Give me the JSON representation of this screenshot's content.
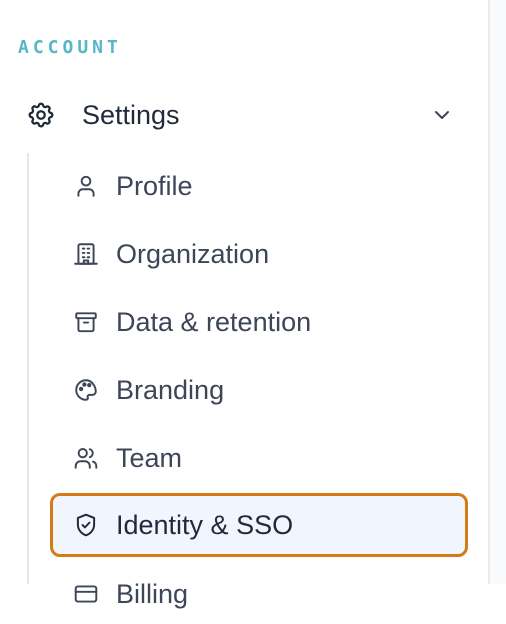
{
  "sidebar": {
    "section_heading": "ACCOUNT",
    "group": {
      "label": "Settings",
      "icon": "gear-icon",
      "expand_icon": "chevron-down-icon"
    },
    "items": [
      {
        "label": "Profile",
        "icon": "user-icon"
      },
      {
        "label": "Organization",
        "icon": "building-icon"
      },
      {
        "label": "Data & retention",
        "icon": "archive-icon"
      },
      {
        "label": "Branding",
        "icon": "palette-icon"
      },
      {
        "label": "Team",
        "icon": "users-icon"
      },
      {
        "label": "Identity & SSO",
        "icon": "shield-check-icon",
        "active": true
      },
      {
        "label": "Billing",
        "icon": "credit-card-icon"
      }
    ]
  },
  "colors": {
    "section_heading": "#57b6c8",
    "active_border": "#d57a14",
    "active_background": "#f1f5fd",
    "text": "#3d4657"
  }
}
